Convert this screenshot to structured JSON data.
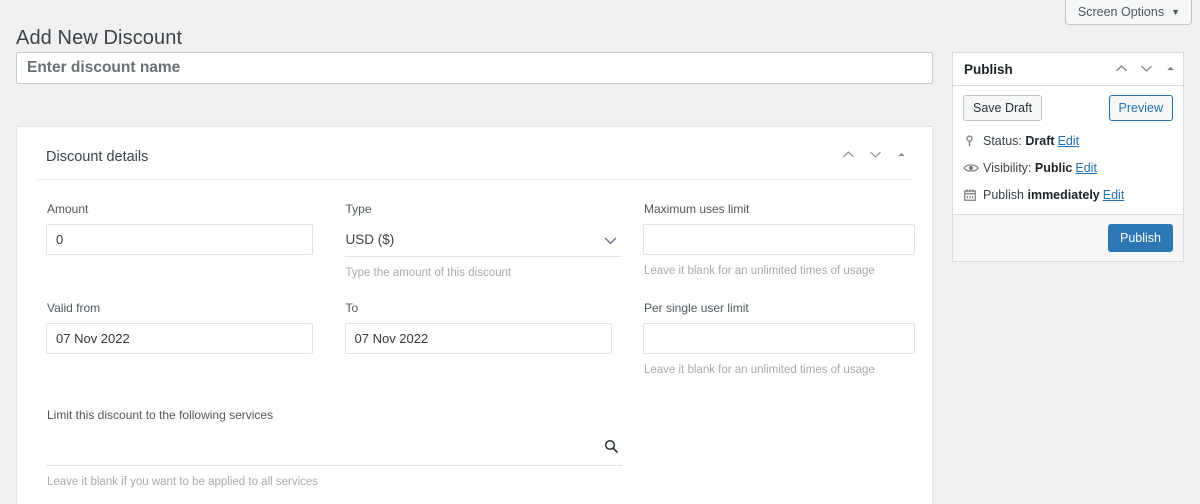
{
  "screen_options": {
    "label": "Screen Options",
    "caret_icon": "caret-down-icon"
  },
  "page": {
    "title": "Add New Discount"
  },
  "title_field": {
    "placeholder": "Enter discount name",
    "value": ""
  },
  "discount_details": {
    "heading": "Discount details",
    "header_icons": [
      "chevron-up-icon",
      "chevron-down-icon",
      "toggle-triangle-up-icon"
    ],
    "fields": {
      "amount": {
        "label": "Amount",
        "value": "0",
        "placeholder": ""
      },
      "type": {
        "label": "Type",
        "value": "USD ($)",
        "help": "Type the amount of this discount",
        "icon": "chevron-down-icon"
      },
      "max_uses": {
        "label": "Maximum uses limit",
        "value": "",
        "placeholder": "",
        "help": "Leave it blank for an unlimited times of usage"
      },
      "valid_from": {
        "label": "Valid from",
        "value": "07 Nov 2022"
      },
      "to": {
        "label": "To",
        "value": "07 Nov 2022"
      },
      "per_user": {
        "label": "Per single user limit",
        "value": "",
        "placeholder": "",
        "help": "Leave it blank for an unlimited times of usage"
      },
      "services": {
        "label": "Limit this discount to the following services",
        "value": "",
        "help": "Leave it blank if you want to be applied to all services",
        "icon": "search-icon"
      }
    }
  },
  "publish": {
    "heading": "Publish",
    "header_icons": [
      "chevron-up-icon",
      "chevron-down-icon",
      "toggle-triangle-up-icon"
    ],
    "save_draft_label": "Save Draft",
    "preview_label": "Preview",
    "status": {
      "icon": "post-status-pin-icon",
      "prefix": "Status: ",
      "value": "Draft",
      "edit": "Edit"
    },
    "visibility": {
      "icon": "eye-icon",
      "prefix": "Visibility: ",
      "value": "Public",
      "edit": "Edit"
    },
    "schedule": {
      "icon": "calendar-icon",
      "prefix": "Publish ",
      "value": "immediately",
      "edit": "Edit"
    },
    "publish_label": "Publish"
  },
  "colors": {
    "page_bg": "#f0f0f1",
    "card_bg": "#ffffff",
    "accent_blue": "#2271b1",
    "publish_button": "#2e77b5",
    "label_gray": "#50575e",
    "help_gray": "#a7aaad",
    "border_gray": "#dcdcde"
  }
}
